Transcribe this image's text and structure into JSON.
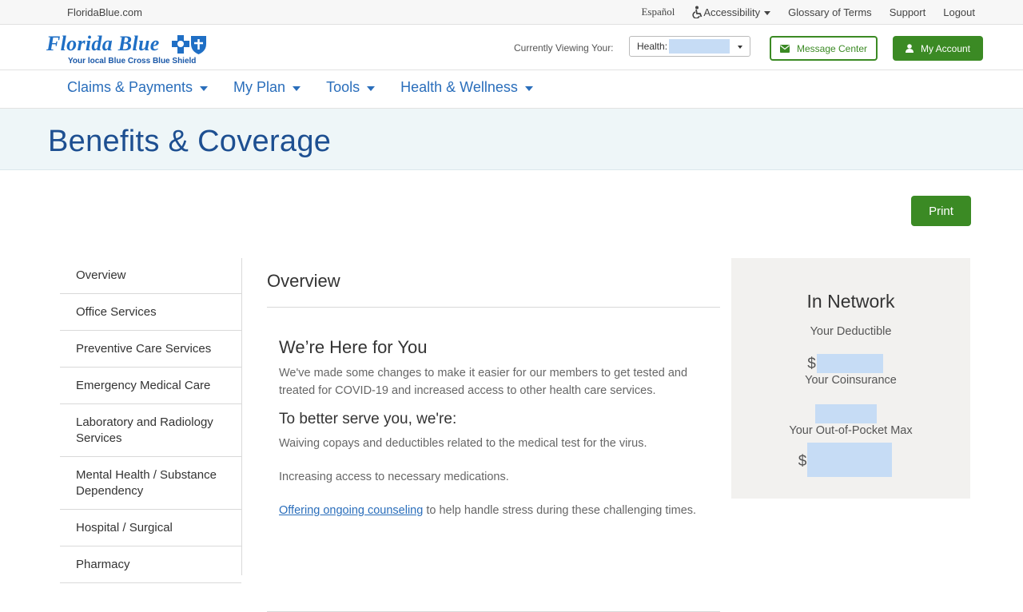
{
  "utility": {
    "site": "FloridaBlue.com",
    "espanol": "Español",
    "accessibility": "Accessibility",
    "glossary": "Glossary of Terms",
    "support": "Support",
    "logout": "Logout"
  },
  "header": {
    "brand": "Florida Blue",
    "tagline": "Your local Blue Cross Blue Shield",
    "viewing_label": "Currently Viewing Your:",
    "health_select_label": "Health:",
    "message_center": "Message Center",
    "my_account": "My Account"
  },
  "nav": [
    {
      "label": "Claims & Payments"
    },
    {
      "label": "My Plan"
    },
    {
      "label": "Tools"
    },
    {
      "label": "Health & Wellness"
    }
  ],
  "page_title": "Benefits & Coverage",
  "print_label": "Print",
  "sidebar": [
    {
      "label": "Overview"
    },
    {
      "label": "Office Services"
    },
    {
      "label": "Preventive Care Services"
    },
    {
      "label": "Emergency Medical Care"
    },
    {
      "label": "Laboratory and Radiology Services"
    },
    {
      "label": "Mental Health / Substance Dependency"
    },
    {
      "label": "Hospital / Surgical"
    },
    {
      "label": "Pharmacy"
    }
  ],
  "main": {
    "heading": "Overview",
    "card_title": "We’re Here for You",
    "intro": "We've made some changes to make it easier for our members to get tested and treated for COVID-19 and increased access to other health care services.",
    "sub_heading": "To better serve you, we're:",
    "point1": "Waiving copays and deductibles related to the medical test for the virus.",
    "point2": "Increasing access to necessary medications.",
    "point3_link": "Offering ongoing counseling",
    "point3_rest": " to help handle stress during these challenging times."
  },
  "network": {
    "title": "In Network",
    "deductible_label": "Your Deductible",
    "currency": "$",
    "coinsurance_label": "Your Coinsurance",
    "oop_label": "Your Out-of-Pocket Max"
  },
  "colors": {
    "brand_blue": "#1d4f91",
    "link_blue": "#2a6ebb",
    "green": "#3b8a24",
    "redaction": "#c6dcf5"
  }
}
